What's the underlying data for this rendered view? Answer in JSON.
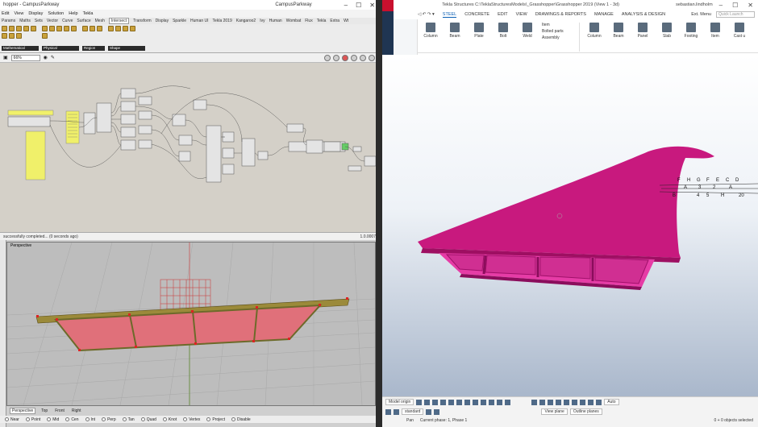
{
  "grasshopper": {
    "window_title": "hopper - CampusParkway",
    "window_title_right": "CampusParkway",
    "menu": [
      "Edit",
      "View",
      "Display",
      "Solution",
      "Help",
      "Tekla"
    ],
    "tabs": [
      "Params",
      "Maths",
      "Sets",
      "Vector",
      "Curve",
      "Surface",
      "Mesh",
      "Intersect",
      "Transform",
      "Display",
      "Sparkle",
      "Human UI",
      "Tekla 2019",
      "Kangaroo2",
      "Ivy",
      "Human",
      "Wombat",
      "Flux",
      "Tekla",
      "Extra",
      "Wt"
    ],
    "active_tab": "Intersect",
    "ribbon_groups": [
      "Mathematical",
      "Physical",
      "Region",
      "Shape"
    ],
    "zoom": "66%",
    "status": "successfully completed... (0 seconds ago)",
    "version": "1.0.0007",
    "accent": "#f0f06a"
  },
  "rhino": {
    "viewport_label": "Perspective",
    "tabs": [
      "Perspective",
      "Top",
      "Front",
      "Right"
    ],
    "active_tab": "Perspective",
    "osnaps": [
      "Near",
      "Point",
      "Mid",
      "Cen",
      "Int",
      "Perp",
      "Tan",
      "Quad",
      "Knot",
      "Vertex",
      "Project",
      "Disable"
    ]
  },
  "tekla": {
    "window_title": "Tekla Structures   C:\\TeklaStructuresModels\\_Grasshopper\\Grasshopper 2019   (View 1 - 3d)",
    "user": "sebastian.lindholm",
    "nav": [
      "STEEL",
      "CONCRETE",
      "EDIT",
      "VIEW",
      "DRAWINGS & REPORTS",
      "MANAGE",
      "ANALYSIS & DESIGN"
    ],
    "active_nav": "STEEL",
    "quick_menu": "Ext. Menu",
    "search_placeholder": "Quick Launch",
    "tools": [
      "Column",
      "Beam",
      "Plate",
      "Bolt",
      "Weld",
      "Item",
      "Bolted parts",
      "Assembly",
      "Column",
      "Beam",
      "Panel",
      "Slab",
      "Footing",
      "Item",
      "Cast u"
    ],
    "bottom_dropdowns": [
      "Model origin",
      "standard",
      "View plane",
      "Outline planes",
      "Auto"
    ],
    "status_left": "Pan",
    "status_mid": "Current phase: 1, Phase 1",
    "status_right": "0 + 0 objects selected",
    "model_color": "#c8197e",
    "gridline_labels": [
      "D",
      "C",
      "H",
      "G",
      "F",
      "E",
      "1",
      "2",
      "3",
      "4",
      "5",
      "A",
      "B",
      "20"
    ]
  }
}
